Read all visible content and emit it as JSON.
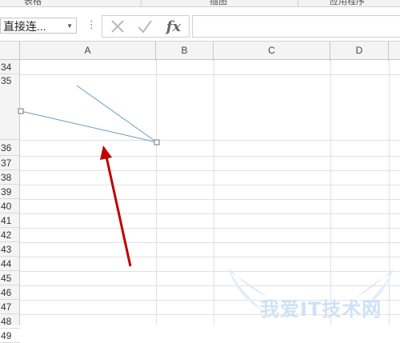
{
  "ribbon": {
    "groups": [
      "表格",
      "插图",
      "应用程序"
    ]
  },
  "formula_bar": {
    "name_box_value": "直接连...",
    "cancel_icon": "cross-icon",
    "enter_icon": "check-icon",
    "function_label": "fx",
    "formula_value": ""
  },
  "sheet": {
    "columns": [
      "A",
      "B",
      "C",
      "D"
    ],
    "rows": [
      "34",
      "35",
      "36",
      "37",
      "38",
      "39",
      "40",
      "41",
      "42",
      "43",
      "44",
      "45",
      "46",
      "47",
      "48",
      "49"
    ]
  },
  "annotations": {
    "connector_line_color": "#6a9ec0",
    "arrow_color": "#c00000"
  },
  "watermark": {
    "text": "我爱IT技术网"
  }
}
